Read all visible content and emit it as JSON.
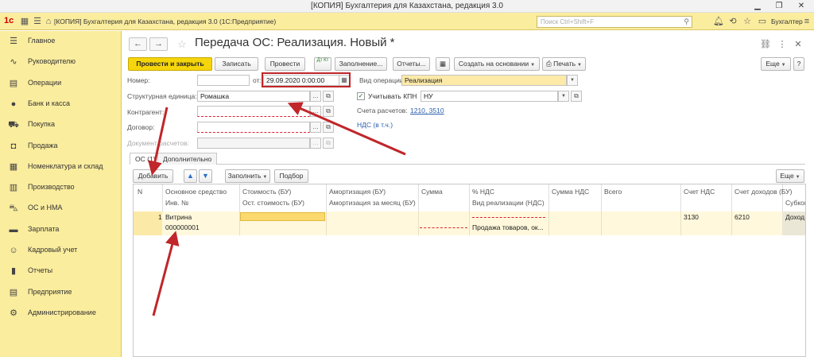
{
  "window": {
    "title": "[КОПИЯ] Бухгалтерия для Казахстана, редакция 3.0",
    "min_glyph": "▁",
    "restore_glyph": "❐",
    "close_glyph": "✕"
  },
  "apptoolbar": {
    "logo": "1с",
    "title": "[КОПИЯ] Бухгалтерия для Казахстана, редакция 3.0 (1С:Предприятие)",
    "search_placeholder": "Поиск Ctrl+Shift+F",
    "user": "Бухгалтер",
    "icons": [
      "grid-icon",
      "menu-icon",
      "home-icon",
      "search-icon",
      "bell-icon",
      "history-icon",
      "star-icon",
      "user-icon",
      "settings-icon"
    ]
  },
  "sidebar": {
    "items": [
      {
        "label": "Главное",
        "icon": "menu-icon",
        "glyph": "☰"
      },
      {
        "label": "Руководителю",
        "icon": "chart-icon",
        "glyph": "∿"
      },
      {
        "label": "Операции",
        "icon": "ledger-icon",
        "glyph": "▤"
      },
      {
        "label": "Банк и касса",
        "icon": "coin-icon",
        "glyph": "●"
      },
      {
        "label": "Покупка",
        "icon": "cart-icon",
        "glyph": "⛟"
      },
      {
        "label": "Продажа",
        "icon": "bag-icon",
        "glyph": "◘"
      },
      {
        "label": "Номенклатура и склад",
        "icon": "grid-icon",
        "glyph": "▦"
      },
      {
        "label": "Производство",
        "icon": "factory-icon",
        "glyph": "▥"
      },
      {
        "label": "ОС и НМА",
        "icon": "car-icon",
        "glyph": "⛍"
      },
      {
        "label": "Зарплата",
        "icon": "wallet-icon",
        "glyph": "▬"
      },
      {
        "label": "Кадровый учет",
        "icon": "people-icon",
        "glyph": "☺"
      },
      {
        "label": "Отчеты",
        "icon": "bars-icon",
        "glyph": "▮"
      },
      {
        "label": "Предприятие",
        "icon": "building-icon",
        "glyph": "▤"
      },
      {
        "label": "Администрирование",
        "icon": "gear-icon",
        "glyph": "⚙"
      }
    ]
  },
  "doc": {
    "title": "Передача ОС: Реализация. Новый *",
    "back_glyph": "←",
    "forward_glyph": "→"
  },
  "toolbar": {
    "post_close": "Провести и закрыть",
    "save": "Записать",
    "post": "Провести",
    "dtkt": "Дт Кт",
    "fill": "Заполнение...",
    "reports": "Отчеты...",
    "create_based": "Создать на основании",
    "print": "Печать",
    "more": "Еще",
    "help": "?"
  },
  "fields": {
    "number_label": "Номер:",
    "number_value": "",
    "date_from_label": "от:",
    "date_value": "29.09.2020  0:00:00",
    "op_label": "Вид операции:",
    "op_value": "Реализация",
    "unit_label": "Структурная единица:",
    "unit_value": "Ромашка",
    "kpn_label": "Учитывать КПН",
    "kpn_checked": true,
    "kpn_value": "НУ",
    "contractor_label": "Контрагент:",
    "contractor_value": "",
    "accounts_label": "Счета расчетов:",
    "accounts_value": "1210, 3510",
    "nds_link": "НДС (в т.ч.)",
    "contract_label": "Договор:",
    "contract_value": "",
    "settle_doc_label": "Документ расчетов:",
    "settle_doc_value": ""
  },
  "tabs": [
    {
      "label": "ОС (1)",
      "active": true
    },
    {
      "label": "Дополнительно",
      "active": false
    }
  ],
  "table_toolbar": {
    "add": "Добавить",
    "up_glyph": "▲",
    "down_glyph": "▼",
    "fill": "Заполнить",
    "selection": "Подбор",
    "more": "Еще"
  },
  "table": {
    "header_top": [
      "N",
      "Основное средство",
      "Стоимость (БУ)",
      "Амортизация (БУ)",
      "Сумма",
      "% НДС",
      "Сумма НДС",
      "Всего",
      "Счет НДС",
      "Счет доходов (БУ)",
      "Субконто"
    ],
    "header_bottom": [
      "Инв. №",
      "Ост. стоимость (БУ)",
      "Амортизация за месяц (БУ)",
      "Вид реализации (НДС)"
    ],
    "rows": [
      {
        "n": "1",
        "asset": "Витрина",
        "inv": "000000001",
        "sale_type": "Продажа товаров, ок...",
        "vat_account": "3130",
        "income_account": "6210",
        "subconto": "Доход"
      }
    ]
  }
}
